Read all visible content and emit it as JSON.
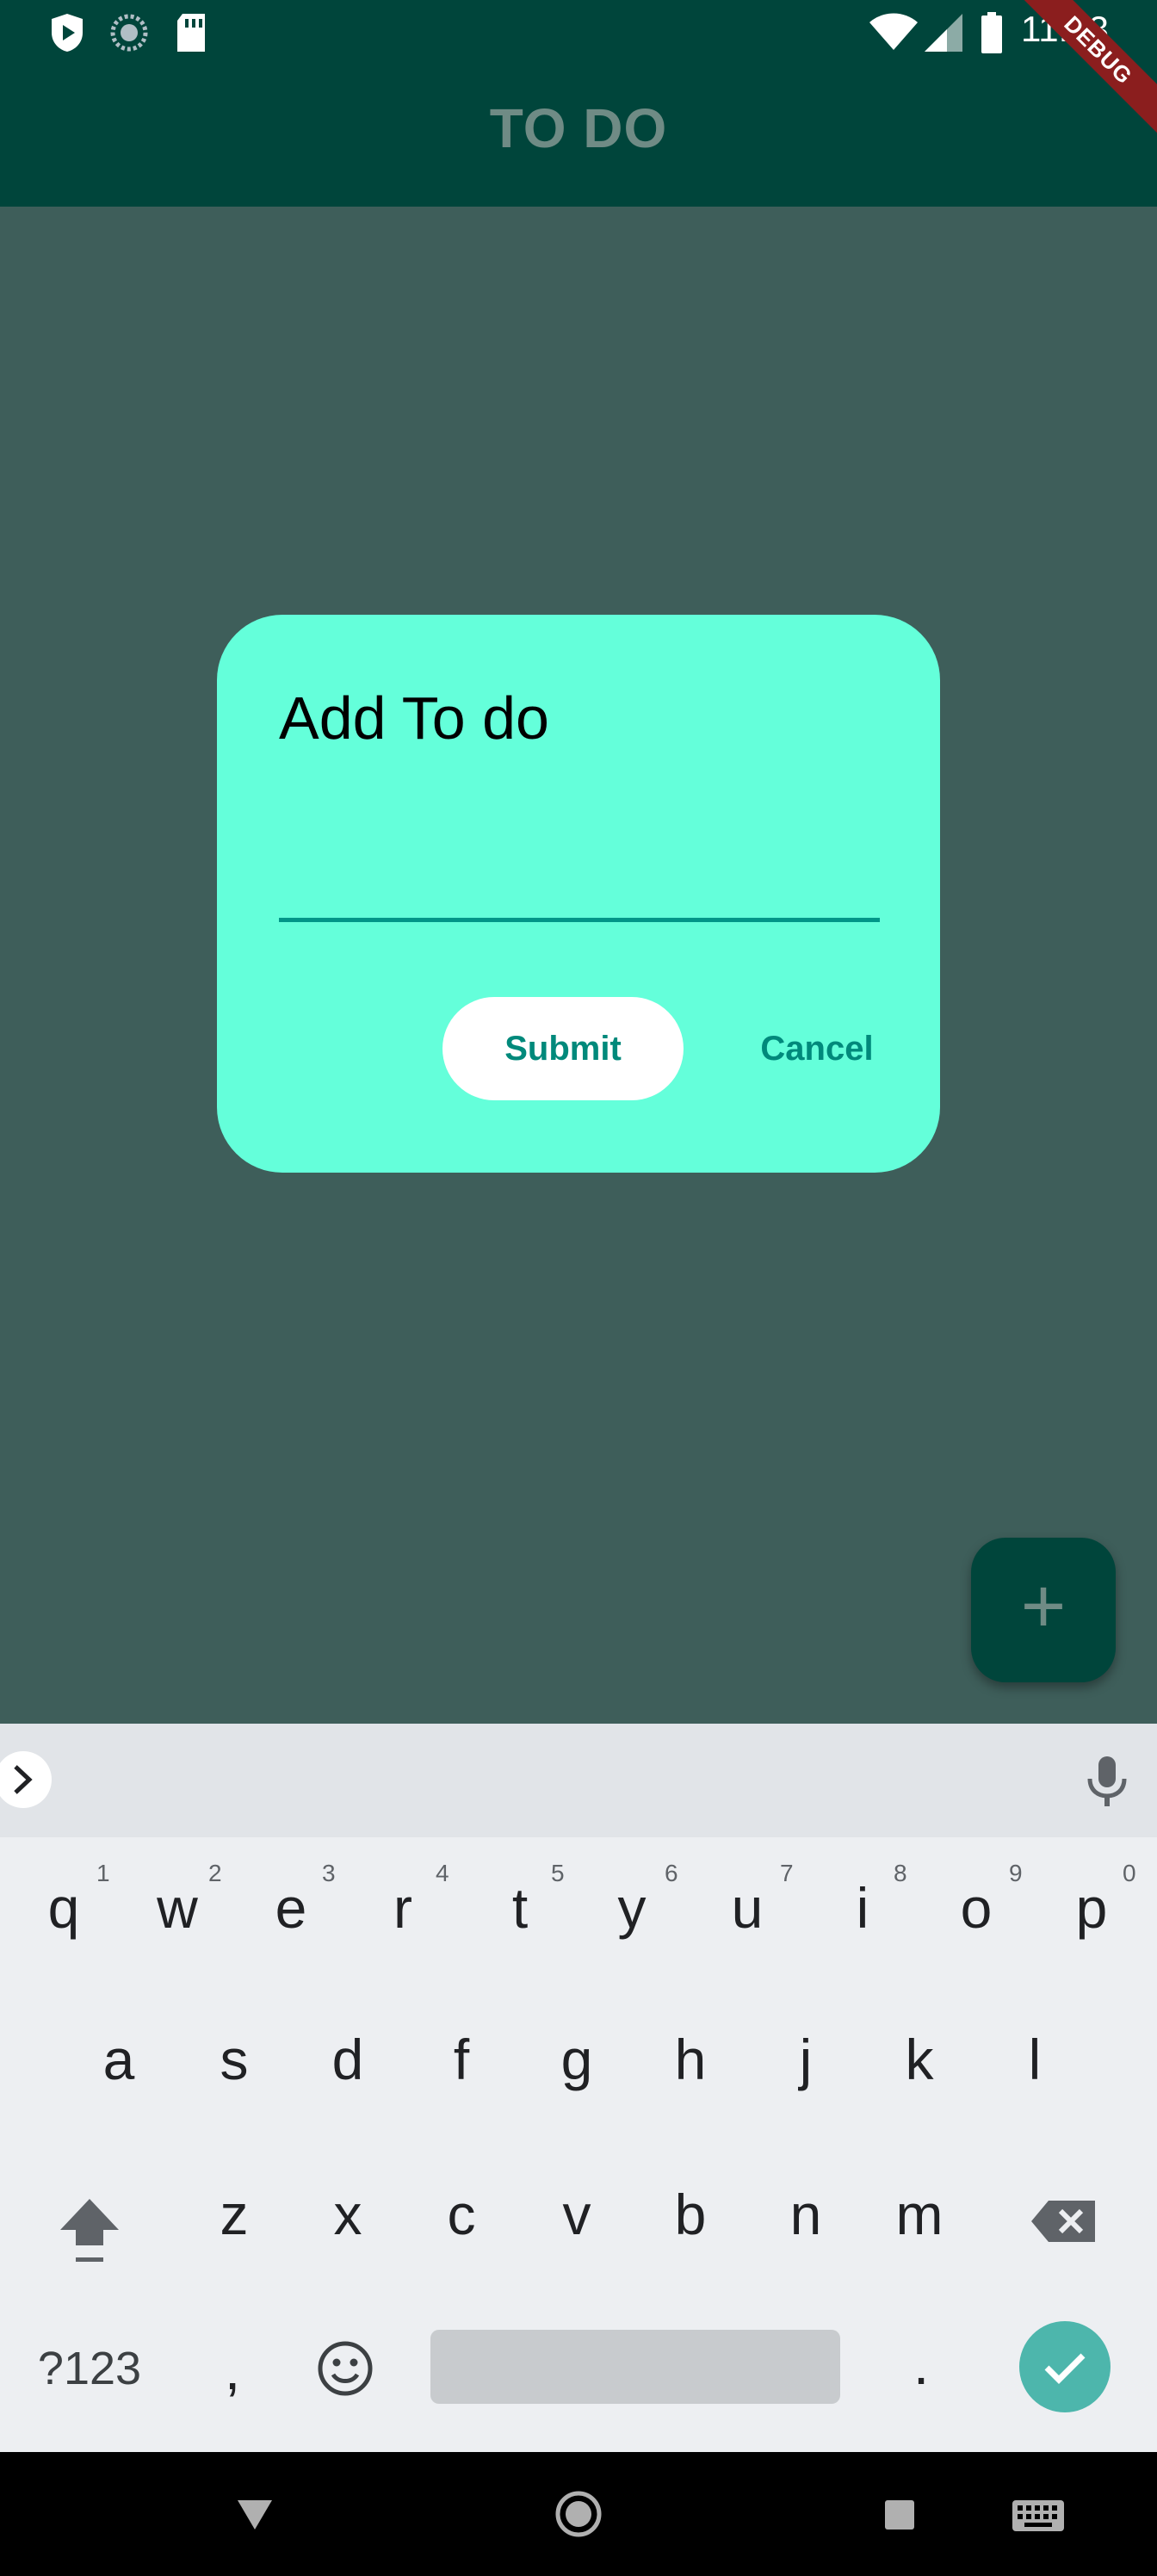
{
  "status_bar": {
    "time": "11:33",
    "icons": [
      "play-shield-icon",
      "sync-circle-icon",
      "sd-card-icon",
      "wifi-icon",
      "cellular-signal-icon",
      "battery-icon"
    ]
  },
  "app_bar": {
    "title": "TO DO",
    "debug_banner": "DEBUG"
  },
  "dialog": {
    "title": "Add To do",
    "input_value": "",
    "submit_label": "Submit",
    "cancel_label": "Cancel"
  },
  "fab": {
    "icon": "plus-icon",
    "label": "+"
  },
  "keyboard": {
    "row1": [
      {
        "key": "q",
        "hint": "1"
      },
      {
        "key": "w",
        "hint": "2"
      },
      {
        "key": "e",
        "hint": "3"
      },
      {
        "key": "r",
        "hint": "4"
      },
      {
        "key": "t",
        "hint": "5"
      },
      {
        "key": "y",
        "hint": "6"
      },
      {
        "key": "u",
        "hint": "7"
      },
      {
        "key": "i",
        "hint": "8"
      },
      {
        "key": "o",
        "hint": "9"
      },
      {
        "key": "p",
        "hint": "0"
      }
    ],
    "row2": [
      "a",
      "s",
      "d",
      "f",
      "g",
      "h",
      "j",
      "k",
      "l"
    ],
    "row3": [
      "z",
      "x",
      "c",
      "v",
      "b",
      "n",
      "m"
    ],
    "symbols_label": "?123",
    "comma_label": ",",
    "period_label": "."
  },
  "colors": {
    "app_bar": "#00453b",
    "scrim": "#3e5e5a",
    "dialog_bg": "#64ffda",
    "accent": "#00897b",
    "debug_ribbon": "#8b1e1e"
  }
}
